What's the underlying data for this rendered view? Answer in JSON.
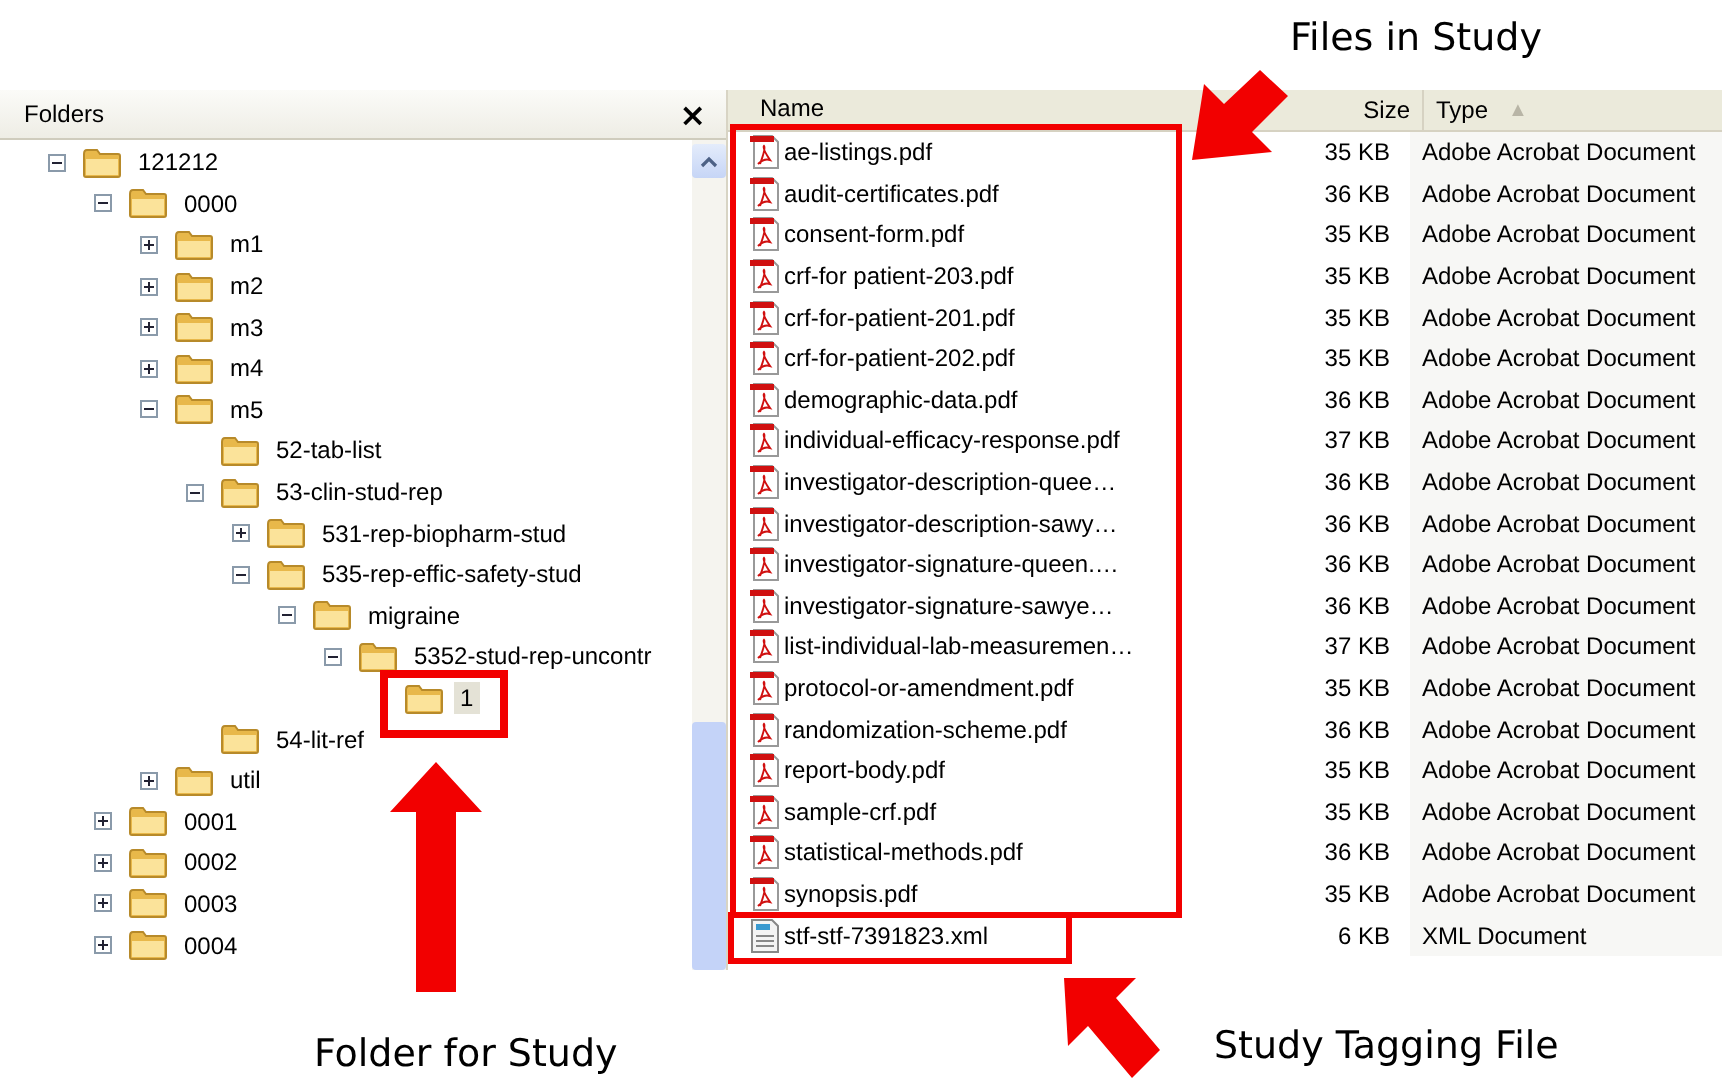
{
  "folders_pane": {
    "title": "Folders",
    "close": "×",
    "tree": [
      {
        "label": "121212",
        "expanded": true,
        "selected": false,
        "children": [
          {
            "label": "0000",
            "expanded": true,
            "selected": false,
            "children": [
              {
                "label": "m1",
                "expanded": false,
                "selected": false
              },
              {
                "label": "m2",
                "expanded": false,
                "selected": false
              },
              {
                "label": "m3",
                "expanded": false,
                "selected": false
              },
              {
                "label": "m4",
                "expanded": false,
                "selected": false
              },
              {
                "label": "m5",
                "expanded": true,
                "selected": false,
                "children": [
                  {
                    "label": "52-tab-list",
                    "selected": false
                  },
                  {
                    "label": "53-clin-stud-rep",
                    "expanded": true,
                    "selected": false,
                    "children": [
                      {
                        "label": "531-rep-biopharm-stud",
                        "expanded": false,
                        "selected": false
                      },
                      {
                        "label": "535-rep-effic-safety-stud",
                        "expanded": true,
                        "selected": false,
                        "children": [
                          {
                            "label": "migraine",
                            "expanded": true,
                            "selected": false,
                            "children": [
                              {
                                "label": "5352-stud-rep-uncontr",
                                "expanded": true,
                                "selected": false,
                                "children": [
                                  {
                                    "label": "1",
                                    "selected": true
                                  }
                                ]
                              }
                            ]
                          }
                        ]
                      }
                    ]
                  },
                  {
                    "label": "54-lit-ref",
                    "selected": false
                  }
                ]
              },
              {
                "label": "util",
                "expanded": false,
                "selected": false
              }
            ]
          },
          {
            "label": "0001",
            "expanded": false,
            "selected": false
          },
          {
            "label": "0002",
            "expanded": false,
            "selected": false
          },
          {
            "label": "0003",
            "expanded": false,
            "selected": false
          },
          {
            "label": "0004",
            "expanded": false,
            "selected": false
          }
        ]
      }
    ]
  },
  "file_list": {
    "columns": [
      {
        "label": "Name"
      },
      {
        "label": "Size"
      },
      {
        "label": "Type",
        "sort_mark": "▲"
      }
    ],
    "rows": [
      {
        "kind": "pdf",
        "name": "ae-listings.pdf",
        "size": "35 KB",
        "type": "Adobe Acrobat Document"
      },
      {
        "kind": "pdf",
        "name": "audit-certificates.pdf",
        "size": "36 KB",
        "type": "Adobe Acrobat Document"
      },
      {
        "kind": "pdf",
        "name": "consent-form.pdf",
        "size": "35 KB",
        "type": "Adobe Acrobat Document"
      },
      {
        "kind": "pdf",
        "name": "crf-for patient-203.pdf",
        "size": "35 KB",
        "type": "Adobe Acrobat Document"
      },
      {
        "kind": "pdf",
        "name": "crf-for-patient-201.pdf",
        "size": "35 KB",
        "type": "Adobe Acrobat Document"
      },
      {
        "kind": "pdf",
        "name": "crf-for-patient-202.pdf",
        "size": "35 KB",
        "type": "Adobe Acrobat Document"
      },
      {
        "kind": "pdf",
        "name": "demographic-data.pdf",
        "size": "36 KB",
        "type": "Adobe Acrobat Document"
      },
      {
        "kind": "pdf",
        "name": "individual-efficacy-response.pdf",
        "size": "37 KB",
        "type": "Adobe Acrobat Document"
      },
      {
        "kind": "pdf",
        "name": "investigator-description-quee…",
        "size": "36 KB",
        "type": "Adobe Acrobat Document"
      },
      {
        "kind": "pdf",
        "name": "investigator-description-sawy…",
        "size": "36 KB",
        "type": "Adobe Acrobat Document"
      },
      {
        "kind": "pdf",
        "name": "investigator-signature-queen.…",
        "size": "36 KB",
        "type": "Adobe Acrobat Document"
      },
      {
        "kind": "pdf",
        "name": "investigator-signature-sawye…",
        "size": "36 KB",
        "type": "Adobe Acrobat Document"
      },
      {
        "kind": "pdf",
        "name": "list-individual-lab-measuremen…",
        "size": "37 KB",
        "type": "Adobe Acrobat Document"
      },
      {
        "kind": "pdf",
        "name": "protocol-or-amendment.pdf",
        "size": "35 KB",
        "type": "Adobe Acrobat Document"
      },
      {
        "kind": "pdf",
        "name": "randomization-scheme.pdf",
        "size": "36 KB",
        "type": "Adobe Acrobat Document"
      },
      {
        "kind": "pdf",
        "name": "report-body.pdf",
        "size": "35 KB",
        "type": "Adobe Acrobat Document"
      },
      {
        "kind": "pdf",
        "name": "sample-crf.pdf",
        "size": "35 KB",
        "type": "Adobe Acrobat Document"
      },
      {
        "kind": "pdf",
        "name": "statistical-methods.pdf",
        "size": "36 KB",
        "type": "Adobe Acrobat Document"
      },
      {
        "kind": "pdf",
        "name": "synopsis.pdf",
        "size": "35 KB",
        "type": "Adobe Acrobat Document"
      },
      {
        "kind": "xml",
        "name": "stf-stf-7391823.xml",
        "size": "6 KB",
        "type": "XML Document"
      }
    ]
  },
  "callouts": [
    {
      "kind": "files",
      "text": "Files in Study"
    },
    {
      "kind": "folder",
      "text": "Folder for Study"
    },
    {
      "kind": "stf",
      "text": "Study Tagging File"
    }
  ]
}
